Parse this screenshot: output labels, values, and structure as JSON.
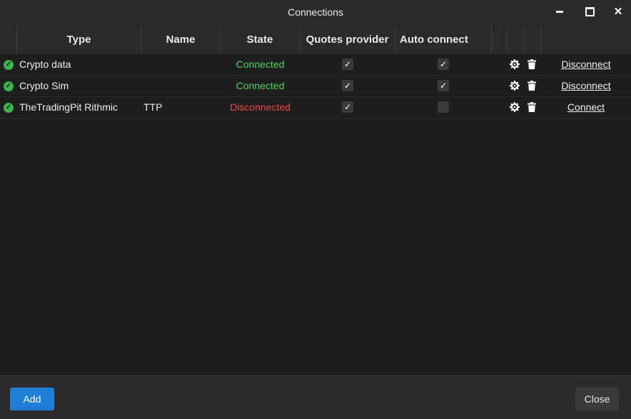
{
  "window": {
    "title": "Connections",
    "controls": [
      "minimize-icon",
      "maximize-icon",
      "close-icon"
    ]
  },
  "table": {
    "columns": [
      "",
      "Type",
      "Name",
      "State",
      "Quotes provider",
      "Auto connect",
      "",
      "",
      ""
    ],
    "rows": [
      {
        "status_icon": "check-circle-icon",
        "type": "Crypto data",
        "name": "",
        "state": "Connected",
        "quotes_provider": true,
        "auto_connect": true,
        "settings_icon": "gear-icon",
        "delete_icon": "trash-icon",
        "action": "Disconnect"
      },
      {
        "status_icon": "check-circle-icon",
        "type": "Crypto Sim",
        "name": "",
        "state": "Connected",
        "quotes_provider": true,
        "auto_connect": true,
        "settings_icon": "gear-icon",
        "delete_icon": "trash-icon",
        "action": "Disconnect"
      },
      {
        "status_icon": "check-circle-icon",
        "type": "TheTradingPit Rithmic",
        "name": "TTP",
        "state": "Disconnected",
        "quotes_provider": true,
        "auto_connect": false,
        "settings_icon": "gear-icon",
        "delete_icon": "trash-icon",
        "action": "Connect"
      }
    ]
  },
  "footer": {
    "add_label": "Add",
    "close_label": "Close"
  },
  "colors": {
    "background": "#1e1e1f",
    "header": "#2a2a2c",
    "connected": "#4fd35a",
    "disconnected": "#e24b4b",
    "status_ok": "#3bb54a",
    "accent_button": "#1f7fd6"
  }
}
